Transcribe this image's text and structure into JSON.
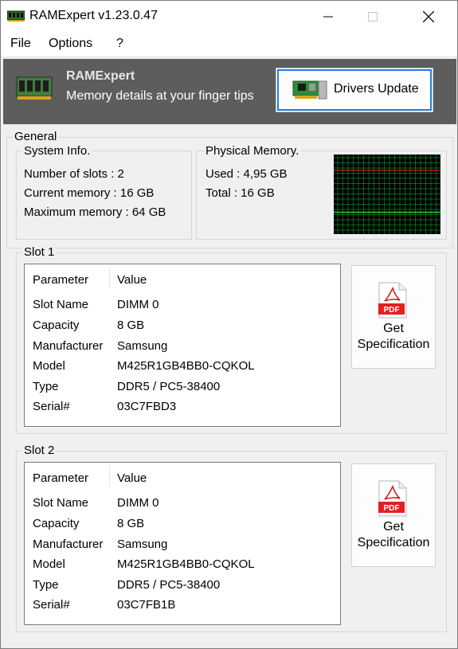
{
  "window": {
    "title": "RAMExpert v1.23.0.47"
  },
  "menu": [
    {
      "label": "File"
    },
    {
      "label": "Options"
    },
    {
      "label": "?"
    }
  ],
  "banner": {
    "title": "RAMExpert",
    "subtitle": "Memory details at your finger tips",
    "drivers_button": "Drivers Update"
  },
  "general": {
    "label": "General",
    "system_info": {
      "label": "System Info.",
      "slots": "Number of slots : 2",
      "current": "Current memory : 16 GB",
      "maximum": "Maximum memory : 64 GB"
    },
    "physical": {
      "label": "Physical Memory.",
      "used": "Used : 4,95 GB",
      "total": "Total : 16 GB"
    }
  },
  "slots": [
    {
      "label": "Slot 1",
      "header": {
        "param": "Parameter",
        "value": "Value"
      },
      "rows": [
        [
          "Slot Name",
          "DIMM 0"
        ],
        [
          "Capacity",
          "8 GB"
        ],
        [
          "Manufacturer",
          "Samsung"
        ],
        [
          "Model",
          "M425R1GB4BB0-CQKOL"
        ],
        [
          "Type",
          "DDR5 / PC5-38400"
        ],
        [
          "Serial#",
          "03C7FBD3"
        ]
      ],
      "spec_button": {
        "line1": "Get",
        "line2": "Specification"
      }
    },
    {
      "label": "Slot 2",
      "header": {
        "param": "Parameter",
        "value": "Value"
      },
      "rows": [
        [
          "Slot Name",
          "DIMM 0"
        ],
        [
          "Capacity",
          "8 GB"
        ],
        [
          "Manufacturer",
          "Samsung"
        ],
        [
          "Model",
          "M425R1GB4BB0-CQKOL"
        ],
        [
          "Type",
          "DDR5 / PC5-38400"
        ],
        [
          "Serial#",
          "03C7FB1B"
        ]
      ],
      "spec_button": {
        "line1": "Get",
        "line2": "Specification"
      }
    }
  ],
  "icons": {
    "app": "ram-module-icon",
    "banner": "ram-module-icon",
    "drivers": "network-card-icon",
    "spec": "pdf-icon"
  },
  "colors": {
    "graph_bg": "#000000",
    "graph_grid": "#0a8a2a",
    "graph_used": "#2bd62b",
    "graph_total": "#e02020",
    "focus": "#1f7dd8"
  }
}
